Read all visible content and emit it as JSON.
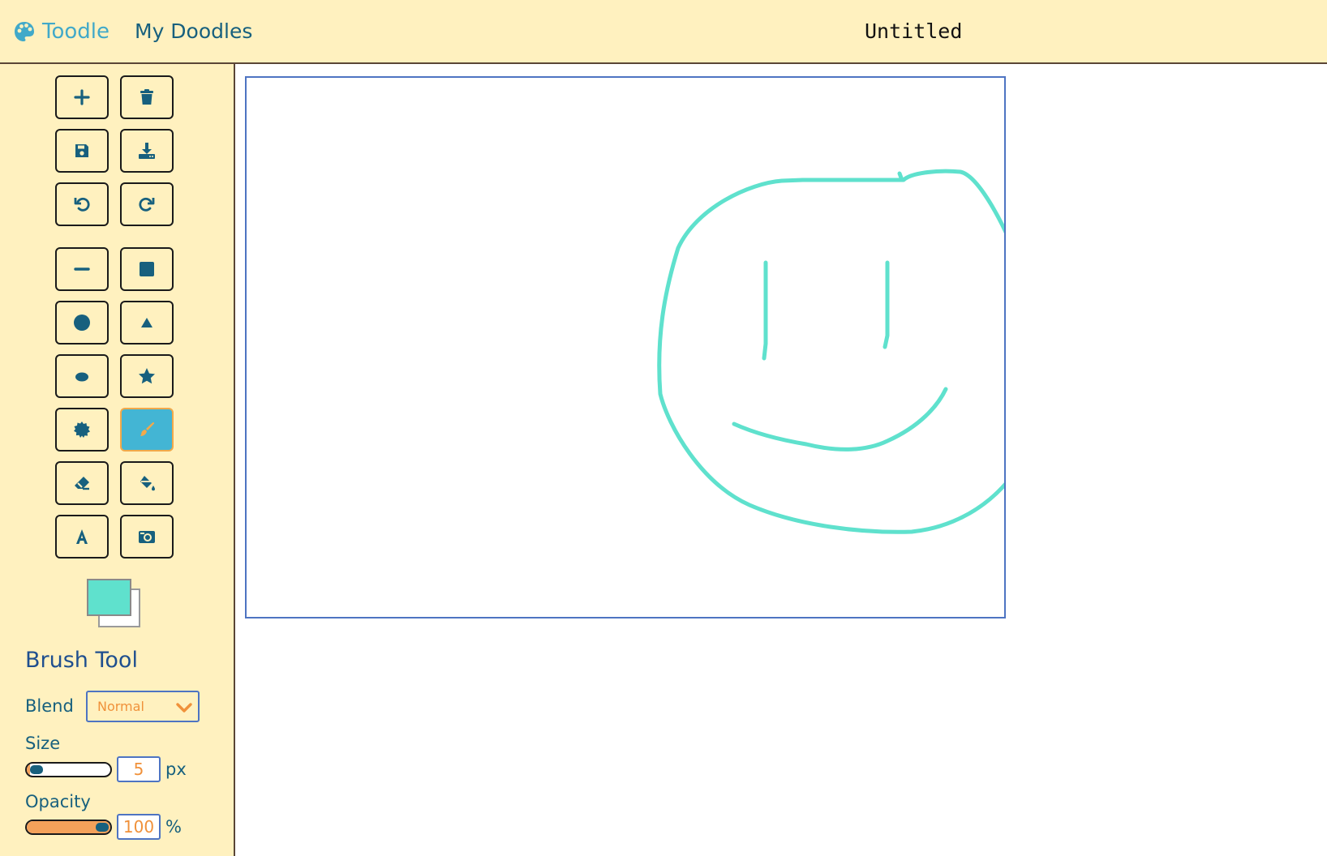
{
  "header": {
    "brand_icon": "palette-icon",
    "brand_name": "Toodle",
    "nav_my_doodles": "My Doodles",
    "document_title": "Untitled"
  },
  "toolbar": {
    "buttons": [
      {
        "name": "new",
        "icon": "plus-icon"
      },
      {
        "name": "delete",
        "icon": "trash-icon"
      },
      {
        "name": "save",
        "icon": "save-icon"
      },
      {
        "name": "download",
        "icon": "download-icon"
      },
      {
        "name": "undo",
        "icon": "undo-icon"
      },
      {
        "name": "redo",
        "icon": "redo-icon"
      },
      {
        "name": "line",
        "icon": "line-icon"
      },
      {
        "name": "rectangle",
        "icon": "square-icon"
      },
      {
        "name": "circle",
        "icon": "circle-icon"
      },
      {
        "name": "triangle",
        "icon": "triangle-icon"
      },
      {
        "name": "ellipse",
        "icon": "ellipse-icon"
      },
      {
        "name": "star",
        "icon": "star-icon"
      },
      {
        "name": "burst",
        "icon": "burst-icon"
      },
      {
        "name": "brush",
        "icon": "paintbrush-icon",
        "active": true
      },
      {
        "name": "eraser",
        "icon": "eraser-icon"
      },
      {
        "name": "fill",
        "icon": "fill-bucket-icon"
      },
      {
        "name": "text",
        "icon": "text-icon"
      },
      {
        "name": "image",
        "icon": "image-icon"
      }
    ],
    "primary_color": "#5fe1cd",
    "secondary_color": "#ffffff"
  },
  "tool_panel": {
    "title": "Brush Tool",
    "blend_label": "Blend",
    "blend_value": "Normal",
    "size_label": "Size",
    "size_value": "5",
    "size_unit": "px",
    "size_fraction": 0.05,
    "opacity_label": "Opacity",
    "opacity_value": "100",
    "opacity_unit": "%",
    "opacity_fraction": 1.0
  },
  "canvas": {
    "stroke_color": "#5fe1cd",
    "drawing": "smiley face sketch"
  },
  "colors": {
    "panel_background": "#fff1bf",
    "active_tool": "#43b5d4",
    "accent_orange": "#f0913a",
    "text_blue": "#17607e"
  }
}
